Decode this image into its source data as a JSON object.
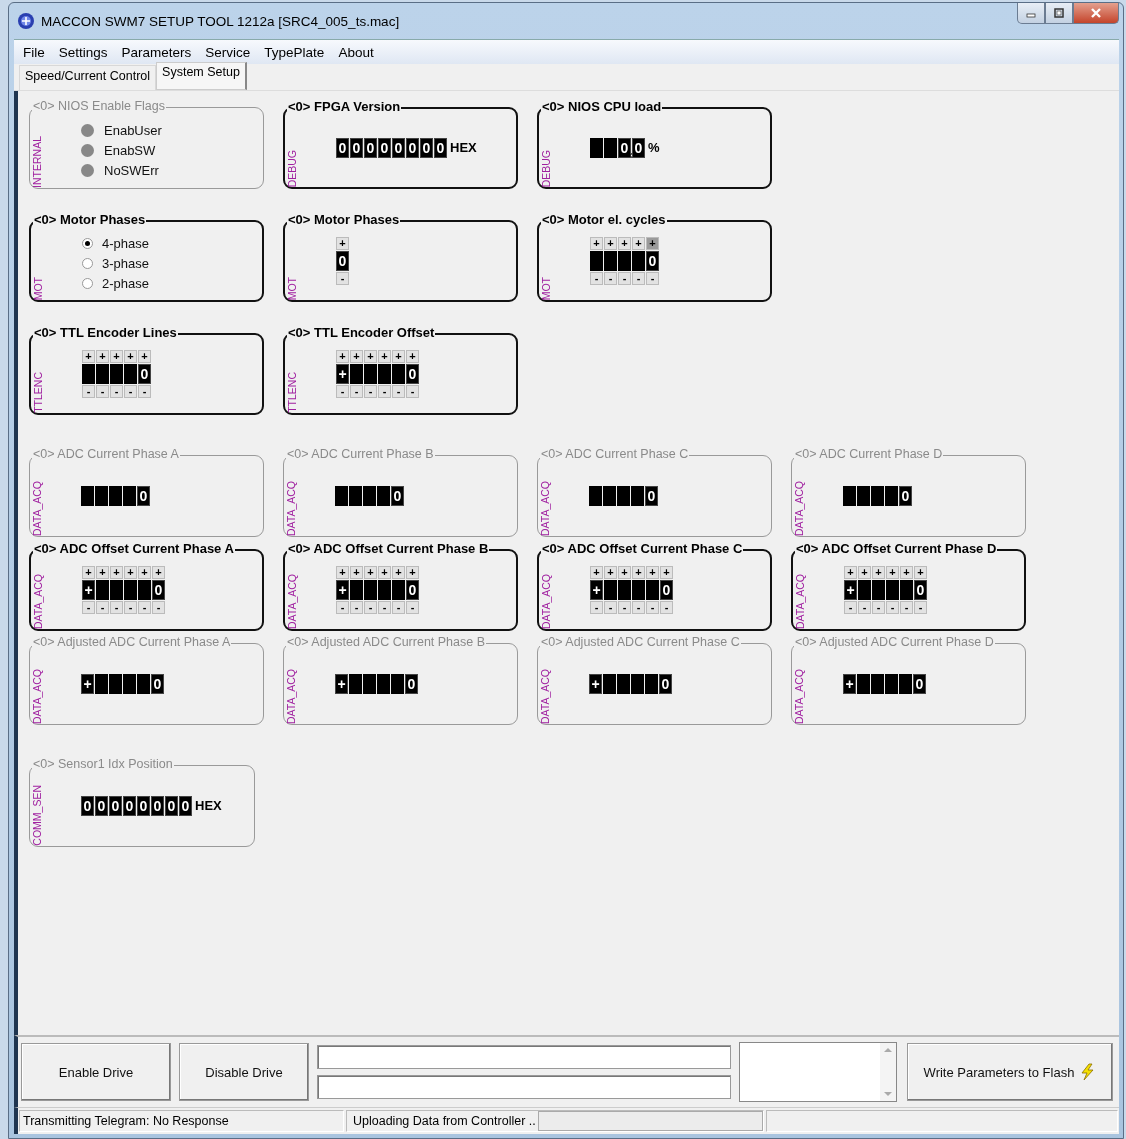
{
  "window": {
    "title": "MACCON SWM7 SETUP TOOL 1212a [SRC4_005_ts.mac]"
  },
  "menu": [
    "File",
    "Settings",
    "Parameters",
    "Service",
    "TypePlate",
    "About"
  ],
  "tabs": [
    {
      "label": "Speed/Current Control",
      "selected": false
    },
    {
      "label": "System Setup",
      "selected": true
    }
  ],
  "rows": [
    [
      {
        "title": "<0> NIOS Enable Flags",
        "tag": "INTERNAL",
        "enabled": false,
        "kind": "flags",
        "flags": [
          {
            "label": "EnabUser",
            "on": false
          },
          {
            "label": "EnabSW",
            "on": false
          },
          {
            "label": "NoSWErr",
            "on": false
          }
        ]
      },
      {
        "title": "<0> FPGA Version",
        "tag": "DEBUG",
        "enabled": true,
        "kind": "display",
        "unit": "HEX",
        "cells": [
          {
            "lit": true,
            "char": "0"
          },
          {
            "lit": true,
            "char": "0"
          },
          {
            "lit": true,
            "char": "0"
          },
          {
            "lit": true,
            "char": "0"
          },
          {
            "lit": true,
            "char": "0"
          },
          {
            "lit": true,
            "char": "0"
          },
          {
            "lit": true,
            "char": "0"
          },
          {
            "lit": true,
            "char": "0"
          }
        ]
      },
      {
        "title": "<0> NIOS CPU load",
        "tag": "DEBUG",
        "enabled": true,
        "kind": "display",
        "unit": "%",
        "cells": [
          {
            "lit": false
          },
          {
            "lit": false
          },
          {
            "lit": true,
            "char": "0",
            "point": true
          },
          {
            "lit": true,
            "char": "0"
          }
        ]
      }
    ],
    [
      {
        "title": "<0> Motor Phases",
        "tag": "MOT",
        "enabled": true,
        "kind": "radio",
        "options": [
          {
            "label": "4-phase",
            "selected": true
          },
          {
            "label": "3-phase",
            "selected": false
          },
          {
            "label": "2-phase",
            "selected": false
          }
        ]
      },
      {
        "title": "<0> Motor Phases",
        "tag": "MOT",
        "enabled": true,
        "kind": "spinner",
        "cells": [
          {
            "lit": true,
            "char": "0",
            "up": "+",
            "down": "-"
          }
        ]
      },
      {
        "title": "<0> Motor el. cycles",
        "tag": "MOT",
        "enabled": true,
        "kind": "spinner",
        "cells": [
          {
            "lit": false,
            "up": "+",
            "down": "-"
          },
          {
            "lit": false,
            "up": "+",
            "down": "-"
          },
          {
            "lit": false,
            "up": "+",
            "down": "-"
          },
          {
            "lit": false,
            "up": "+",
            "down": "-"
          },
          {
            "lit": true,
            "char": "0",
            "up": "+",
            "down": "-",
            "hovered": true
          }
        ]
      }
    ],
    [
      {
        "title": "<0> TTL Encoder Lines",
        "tag": "TTLENC",
        "enabled": true,
        "kind": "spinner",
        "cells": [
          {
            "lit": false,
            "up": "+",
            "down": "-"
          },
          {
            "lit": false,
            "up": "+",
            "down": "-"
          },
          {
            "lit": false,
            "up": "+",
            "down": "-"
          },
          {
            "lit": false,
            "up": "+",
            "down": "-"
          },
          {
            "lit": true,
            "char": "0",
            "up": "+",
            "down": "-"
          }
        ]
      },
      {
        "title": "<0> TTL Encoder Offset",
        "tag": "TTLENC",
        "enabled": true,
        "kind": "spinner",
        "cells": [
          {
            "lit": true,
            "char": "+",
            "up": "+",
            "down": "-"
          },
          {
            "lit": false,
            "up": "+",
            "down": "-"
          },
          {
            "lit": false,
            "up": "+",
            "down": "-"
          },
          {
            "lit": false,
            "up": "+",
            "down": "-"
          },
          {
            "lit": false,
            "up": "+",
            "down": "-"
          },
          {
            "lit": true,
            "char": "0",
            "up": "+",
            "down": "-"
          }
        ]
      }
    ],
    [
      {
        "title": "<0> ADC Current Phase A",
        "tag": "DATA_ACQ",
        "enabled": false,
        "kind": "display",
        "cells": [
          {
            "lit": false
          },
          {
            "lit": false
          },
          {
            "lit": false
          },
          {
            "lit": false
          },
          {
            "lit": true,
            "char": "0"
          }
        ]
      },
      {
        "title": "<0> ADC Current Phase B",
        "tag": "DATA_ACQ",
        "enabled": false,
        "kind": "display",
        "cells": [
          {
            "lit": false
          },
          {
            "lit": false
          },
          {
            "lit": false
          },
          {
            "lit": false
          },
          {
            "lit": true,
            "char": "0"
          }
        ]
      },
      {
        "title": "<0> ADC Current Phase C",
        "tag": "DATA_ACQ",
        "enabled": false,
        "kind": "display",
        "cells": [
          {
            "lit": false
          },
          {
            "lit": false
          },
          {
            "lit": false
          },
          {
            "lit": false
          },
          {
            "lit": true,
            "char": "0"
          }
        ]
      },
      {
        "title": "<0> ADC Current Phase D",
        "tag": "DATA_ACQ",
        "enabled": false,
        "kind": "display",
        "cells": [
          {
            "lit": false
          },
          {
            "lit": false
          },
          {
            "lit": false
          },
          {
            "lit": false
          },
          {
            "lit": true,
            "char": "0"
          }
        ]
      }
    ],
    [
      {
        "title": "<0> ADC Offset Current Phase A",
        "tag": "DATA_ACQ",
        "enabled": true,
        "kind": "spinner",
        "cells": [
          {
            "lit": true,
            "char": "+",
            "up": "+",
            "down": "-"
          },
          {
            "lit": false,
            "up": "+",
            "down": "-"
          },
          {
            "lit": false,
            "up": "+",
            "down": "-"
          },
          {
            "lit": false,
            "up": "+",
            "down": "-"
          },
          {
            "lit": false,
            "up": "+",
            "down": "-"
          },
          {
            "lit": true,
            "char": "0",
            "up": "+",
            "down": "-"
          }
        ]
      },
      {
        "title": "<0> ADC Offset Current Phase B",
        "tag": "DATA_ACQ",
        "enabled": true,
        "kind": "spinner",
        "cells": [
          {
            "lit": true,
            "char": "+",
            "up": "+",
            "down": "-"
          },
          {
            "lit": false,
            "up": "+",
            "down": "-"
          },
          {
            "lit": false,
            "up": "+",
            "down": "-"
          },
          {
            "lit": false,
            "up": "+",
            "down": "-"
          },
          {
            "lit": false,
            "up": "+",
            "down": "-"
          },
          {
            "lit": true,
            "char": "0",
            "up": "+",
            "down": "-"
          }
        ]
      },
      {
        "title": "<0> ADC Offset Current Phase C",
        "tag": "DATA_ACQ",
        "enabled": true,
        "kind": "spinner",
        "cells": [
          {
            "lit": true,
            "char": "+",
            "up": "+",
            "down": "-"
          },
          {
            "lit": false,
            "up": "+",
            "down": "-"
          },
          {
            "lit": false,
            "up": "+",
            "down": "-"
          },
          {
            "lit": false,
            "up": "+",
            "down": "-"
          },
          {
            "lit": false,
            "up": "+",
            "down": "-"
          },
          {
            "lit": true,
            "char": "0",
            "up": "+",
            "down": "-"
          }
        ]
      },
      {
        "title": "<0> ADC Offset Current Phase D",
        "tag": "DATA_ACQ",
        "enabled": true,
        "kind": "spinner",
        "cells": [
          {
            "lit": true,
            "char": "+",
            "up": "+",
            "down": "-"
          },
          {
            "lit": false,
            "up": "+",
            "down": "-"
          },
          {
            "lit": false,
            "up": "+",
            "down": "-"
          },
          {
            "lit": false,
            "up": "+",
            "down": "-"
          },
          {
            "lit": false,
            "up": "+",
            "down": "-"
          },
          {
            "lit": true,
            "char": "0",
            "up": "+",
            "down": "-"
          }
        ]
      }
    ],
    [
      {
        "title": "<0> Adjusted ADC Current Phase A",
        "tag": "DATA_ACQ",
        "enabled": false,
        "kind": "display",
        "cells": [
          {
            "lit": true,
            "char": "+"
          },
          {
            "lit": false
          },
          {
            "lit": false
          },
          {
            "lit": false
          },
          {
            "lit": false
          },
          {
            "lit": true,
            "char": "0"
          }
        ]
      },
      {
        "title": "<0> Adjusted ADC Current Phase B",
        "tag": "DATA_ACQ",
        "enabled": false,
        "kind": "display",
        "cells": [
          {
            "lit": true,
            "char": "+"
          },
          {
            "lit": false
          },
          {
            "lit": false
          },
          {
            "lit": false
          },
          {
            "lit": false
          },
          {
            "lit": true,
            "char": "0"
          }
        ]
      },
      {
        "title": "<0> Adjusted ADC Current Phase C",
        "tag": "DATA_ACQ",
        "enabled": false,
        "kind": "display",
        "cells": [
          {
            "lit": true,
            "char": "+"
          },
          {
            "lit": false
          },
          {
            "lit": false
          },
          {
            "lit": false
          },
          {
            "lit": false
          },
          {
            "lit": true,
            "char": "0"
          }
        ]
      },
      {
        "title": "<0> Adjusted ADC Current Phase D",
        "tag": "DATA_ACQ",
        "enabled": false,
        "kind": "display",
        "cells": [
          {
            "lit": true,
            "char": "+"
          },
          {
            "lit": false
          },
          {
            "lit": false
          },
          {
            "lit": false
          },
          {
            "lit": false
          },
          {
            "lit": true,
            "char": "0"
          }
        ]
      }
    ],
    [
      {
        "title": "<0> Sensor1 Idx Position",
        "tag": "COMM_SEN",
        "enabled": false,
        "kind": "display",
        "unit": "HEX",
        "cells": [
          {
            "lit": true,
            "char": "0"
          },
          {
            "lit": true,
            "char": "0"
          },
          {
            "lit": true,
            "char": "0"
          },
          {
            "lit": true,
            "char": "0"
          },
          {
            "lit": true,
            "char": "0"
          },
          {
            "lit": true,
            "char": "0"
          },
          {
            "lit": true,
            "char": "0"
          },
          {
            "lit": true,
            "char": "0"
          }
        ]
      }
    ]
  ],
  "bottom": {
    "buttons": [
      "Enable Drive",
      "Disable Drive"
    ],
    "flash_button": "Write Parameters to Flash"
  },
  "status_bar": {
    "message": "Transmitting Telegram: No Response",
    "upload": "Uploading Data from Controller ..",
    "progress": {
      "level": 0
    }
  }
}
